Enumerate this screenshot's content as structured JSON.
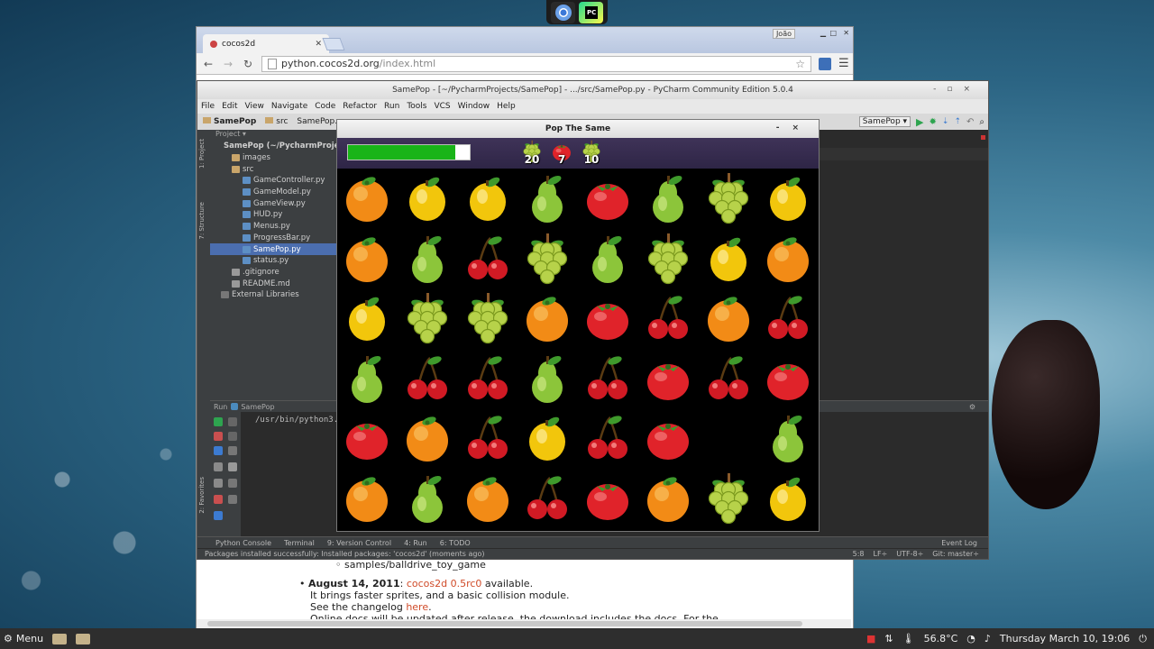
{
  "dock": {
    "icons": [
      "chromium-icon",
      "pycharm-icon"
    ]
  },
  "browser": {
    "tab_title": "cocos2d",
    "user_label": "João",
    "url_host": "python.cocos2d.org",
    "url_path": "/index.html",
    "page": {
      "list_item": "samples/balldrive_toy_game",
      "news_date": "August 14, 2011",
      "news_link": "cocos2d 0.5rc0",
      "news_suffix": " available.",
      "line2": "It brings faster sprites, and a basic collision module.",
      "line3_prefix": "See the changelog ",
      "line3_link": "here",
      "line3_suffix": ".",
      "line4": "Online docs will be updated after release, the download includes the docs. For the"
    }
  },
  "pycharm": {
    "title": "SamePop - [~/PycharmProjects/SamePop] - .../src/SamePop.py - PyCharm Community Edition 5.0.4",
    "menu": [
      "File",
      "Edit",
      "View",
      "Navigate",
      "Code",
      "Refactor",
      "Run",
      "Tools",
      "VCS",
      "Window",
      "Help"
    ],
    "breadcrumb": [
      "SamePop",
      "src",
      "SamePop.py"
    ],
    "run_config": "SamePop",
    "project_header": "Project",
    "tree": [
      {
        "label": "SamePop (~/PycharmProjects/SamePop)",
        "indent": 1,
        "type": "folder",
        "bold": true
      },
      {
        "label": "images",
        "indent": 2,
        "type": "folder"
      },
      {
        "label": "src",
        "indent": 2,
        "type": "folder"
      },
      {
        "label": "GameController.py",
        "indent": 3,
        "type": "pyfile"
      },
      {
        "label": "GameModel.py",
        "indent": 3,
        "type": "pyfile"
      },
      {
        "label": "GameView.py",
        "indent": 3,
        "type": "pyfile"
      },
      {
        "label": "HUD.py",
        "indent": 3,
        "type": "pyfile"
      },
      {
        "label": "Menus.py",
        "indent": 3,
        "type": "pyfile"
      },
      {
        "label": "ProgressBar.py",
        "indent": 3,
        "type": "pyfile"
      },
      {
        "label": "SamePop.py",
        "indent": 3,
        "type": "pyfile",
        "selected": true
      },
      {
        "label": "status.py",
        "indent": 3,
        "type": "pyfile"
      },
      {
        "label": ".gitignore",
        "indent": 2,
        "type": "mdfile"
      },
      {
        "label": "README.md",
        "indent": 2,
        "type": "mdfile"
      },
      {
        "label": "External Libraries",
        "indent": 1,
        "type": "libico"
      }
    ],
    "side_tabs": {
      "project": "1: Project",
      "structure": "7: Structure",
      "favorites": "2: Favorites"
    },
    "run_label": "Run",
    "run_target": "SamePop",
    "run_command": "/usr/bin/python3.",
    "bottom_tabs": [
      "Python Console",
      "Terminal",
      "9: Version Control",
      "4: Run",
      "6: TODO"
    ],
    "event_log": "Event Log",
    "status_message": "Packages installed successfully: Installed packages: 'cocos2d' (moments ago)",
    "status_right": [
      "5:8",
      "LF÷",
      "UTF-8÷",
      "Git: master÷"
    ]
  },
  "game": {
    "title": "Pop The Same",
    "progress": 0.88,
    "goals": [
      {
        "fruit": "grapes",
        "count": "20"
      },
      {
        "fruit": "tomato",
        "count": "7"
      },
      {
        "fruit": "grapes",
        "count": "10"
      }
    ],
    "board": [
      [
        "orange",
        "lemon",
        "lemon",
        "pear",
        "tomato",
        "pear",
        "grapes",
        "lemon"
      ],
      [
        "orange",
        "pear",
        "cherry",
        "grapes",
        "pear",
        "grapes",
        "lemon",
        "orange"
      ],
      [
        "lemon",
        "grapes",
        "grapes",
        "orange",
        "tomato",
        "cherry",
        "orange",
        "cherry"
      ],
      [
        "pear",
        "cherry",
        "cherry",
        "pear",
        "cherry",
        "tomato",
        "cherry",
        "tomato"
      ],
      [
        "tomato",
        "orange",
        "cherry",
        "lemon",
        "cherry",
        "tomato",
        "",
        "pear"
      ],
      [
        "orange",
        "pear",
        "orange",
        "cherry",
        "tomato",
        "orange",
        "grapes",
        "lemon"
      ]
    ]
  },
  "taskbar": {
    "menu_label": "Menu",
    "temperature": "56.8°C",
    "datetime": "Thursday March 10, 19:06"
  }
}
